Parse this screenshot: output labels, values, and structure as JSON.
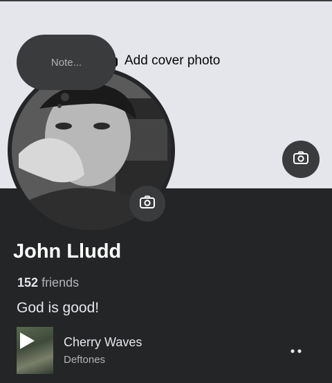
{
  "cover": {
    "add_cover_label": "Add cover photo",
    "background_color": "#e4e6eb",
    "icons": [
      "camera-icon"
    ]
  },
  "note": {
    "placeholder": "Note..."
  },
  "profile": {
    "name": "John Lludd",
    "friends_count": "152",
    "friends_label": "friends",
    "bio": "God is good!"
  },
  "music": {
    "song_title": "Cherry Waves",
    "artist": "Deftones",
    "icons": [
      "play-icon",
      "more-icon"
    ]
  },
  "colors": {
    "background": "#242526",
    "surface": "#3a3b3c",
    "text_primary": "#e4e6eb",
    "text_secondary": "#b0b3b8"
  }
}
